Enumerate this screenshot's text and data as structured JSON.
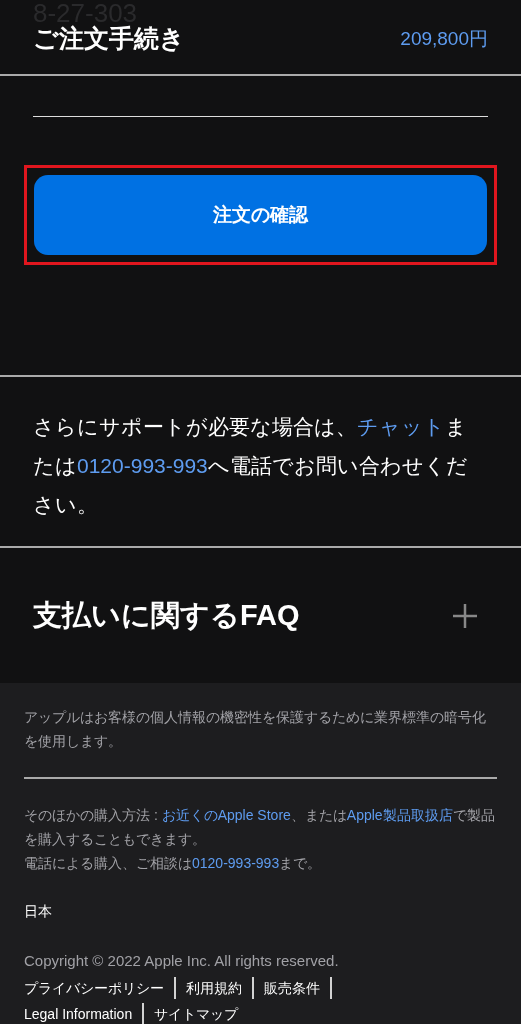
{
  "header": {
    "background_text": "8-27-303",
    "title": "ご注文手続き",
    "total": "209,800円"
  },
  "confirm_button": {
    "label": "注文の確認",
    "highlighted": true
  },
  "support": [
    {
      "kind": "text",
      "text": "さらにサポートが必要な場合は、"
    },
    {
      "kind": "link",
      "text": "チャット"
    },
    {
      "kind": "text",
      "text": "または"
    },
    {
      "kind": "link",
      "text": "0120-993-993"
    },
    {
      "kind": "text",
      "text": "へ電話でお問い合わせください。"
    }
  ],
  "faq": {
    "title": "支払いに関するFAQ",
    "expanded": false
  },
  "footer": {
    "security_note": "アップルはお客様の個人情報の機密性を保護するために業界標準の暗号化を使用します。",
    "purchase_info": [
      {
        "kind": "text",
        "text": "そのほかの購入方法 : "
      },
      {
        "kind": "link",
        "text": "お近くのApple Store"
      },
      {
        "kind": "text",
        "text": "、または"
      },
      {
        "kind": "link",
        "text": "Apple製品取扱店"
      },
      {
        "kind": "text",
        "text": "で製品を購入することもできます。"
      },
      {
        "kind": "break"
      },
      {
        "kind": "text",
        "text": "電話による購入、ご相談は"
      },
      {
        "kind": "link",
        "text": "0120-993-993"
      },
      {
        "kind": "text",
        "text": "まで。"
      }
    ],
    "country": "日本",
    "copyright": "Copyright © 2022 Apple Inc. All rights reserved.",
    "links": [
      "プライバシーポリシー",
      "利用規約",
      "販売条件",
      "Legal Information",
      "サイトマップ"
    ]
  }
}
